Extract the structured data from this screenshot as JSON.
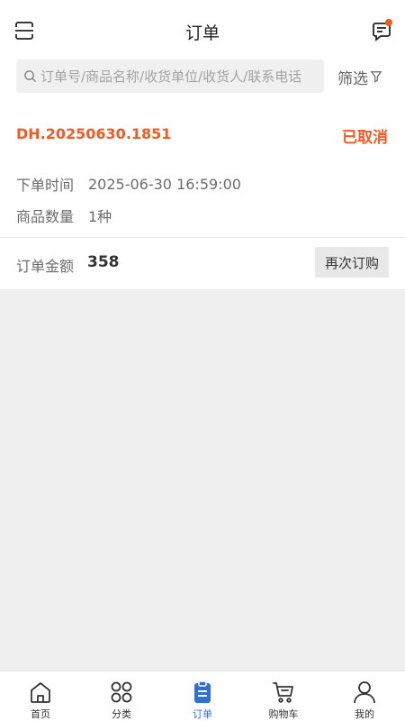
{
  "header": {
    "title": "订单",
    "scan_icon": "scan-icon",
    "message_icon": "message-icon",
    "notification_color": "#f05a23"
  },
  "search": {
    "placeholder": "订单号/商品名称/收货单位/收货人/联系电话",
    "value": "",
    "filter_label": "筛选"
  },
  "orders": [
    {
      "order_no": "DH.20250630.1851",
      "status": "已取消",
      "time_label": "下单时间",
      "time_value": "2025-06-30 16:59:00",
      "qty_label": "商品数量",
      "qty_value": "1种",
      "amount_label": "订单金额",
      "amount_value": "358",
      "reorder_label": "再次订购"
    }
  ],
  "tabbar": {
    "items": [
      {
        "label": "首页",
        "icon": "home-icon"
      },
      {
        "label": "分类",
        "icon": "category-icon"
      },
      {
        "label": "订单",
        "icon": "order-icon",
        "active": true
      },
      {
        "label": "购物车",
        "icon": "cart-icon"
      },
      {
        "label": "我的",
        "icon": "user-icon"
      }
    ]
  },
  "colors": {
    "accent": "#f05a23",
    "active_tab": "#2f6fd6"
  }
}
